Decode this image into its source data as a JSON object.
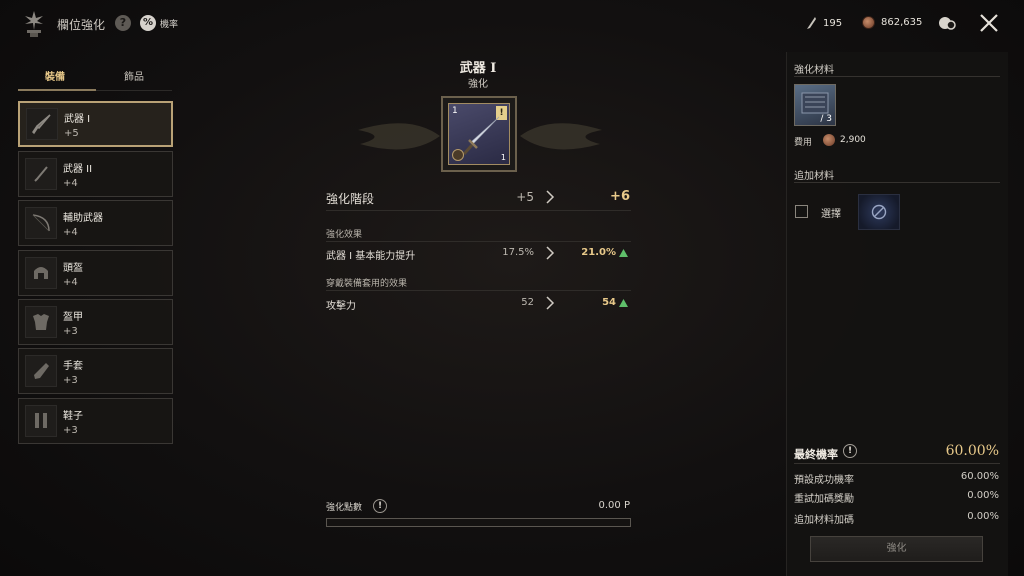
{
  "header": {
    "title": "欄位強化",
    "help_icon_glyph": "?",
    "probability_label": "機率",
    "probability_icon_glyph": "%",
    "resources": [
      {
        "icon": "feather-icon",
        "value": "195"
      },
      {
        "icon": "coin-icon",
        "value": "862,635"
      }
    ]
  },
  "left": {
    "tabs": [
      {
        "label": "裝備",
        "active": true
      },
      {
        "label": "飾品",
        "active": false
      }
    ],
    "slots": [
      {
        "name": "武器 I",
        "level": "+5",
        "icon": "sword-icon",
        "selected": true
      },
      {
        "name": "武器 II",
        "level": "+4",
        "icon": "dagger-icon",
        "selected": false
      },
      {
        "name": "輔助武器",
        "level": "+4",
        "icon": "bow-icon",
        "selected": false
      },
      {
        "name": "頭盔",
        "level": "+4",
        "icon": "helmet-icon",
        "selected": false
      },
      {
        "name": "盔甲",
        "level": "+3",
        "icon": "armor-icon",
        "selected": false
      },
      {
        "name": "手套",
        "level": "+3",
        "icon": "gloves-icon",
        "selected": false
      },
      {
        "name": "鞋子",
        "level": "+3",
        "icon": "boots-icon",
        "selected": false
      }
    ]
  },
  "center": {
    "title": "武器 I",
    "subtitle": "強化",
    "item": {
      "slot_number": "1",
      "warn_glyph": "!",
      "count": "1"
    },
    "stage": {
      "label": "強化階段",
      "current": "+5",
      "next": "+6"
    },
    "effect_section": "強化效果",
    "effect_row": {
      "label": "武器 I 基本能力提升",
      "current": "17.5%",
      "next": "21.0%"
    },
    "set_section": "穿戴裝備套用的效果",
    "set_row": {
      "label": "攻擊力",
      "current": "52",
      "next": "54"
    },
    "points": {
      "label": "強化點數",
      "warn_glyph": "!",
      "value": "0.00 P",
      "progress": 0
    }
  },
  "right": {
    "materials_heading": "強化材料",
    "material_qty": "/ 3",
    "cost_label": "費用",
    "cost_value": "2,900",
    "extra_heading": "追加材料",
    "select_label": "選擇",
    "final": {
      "label": "最終機率",
      "warn_glyph": "!",
      "value": "60.00%"
    },
    "stats": [
      {
        "label": "預設成功機率",
        "value": "60.00%"
      },
      {
        "label": "重試加碼獎勵",
        "value": "0.00%"
      },
      {
        "label": "追加材料加碼",
        "value": "0.00%"
      }
    ],
    "enhance_button": "強化"
  },
  "colors": {
    "accent_gold": "#e8c98a",
    "up_green": "#5fbf6a",
    "frame_gold": "#b9a276"
  }
}
